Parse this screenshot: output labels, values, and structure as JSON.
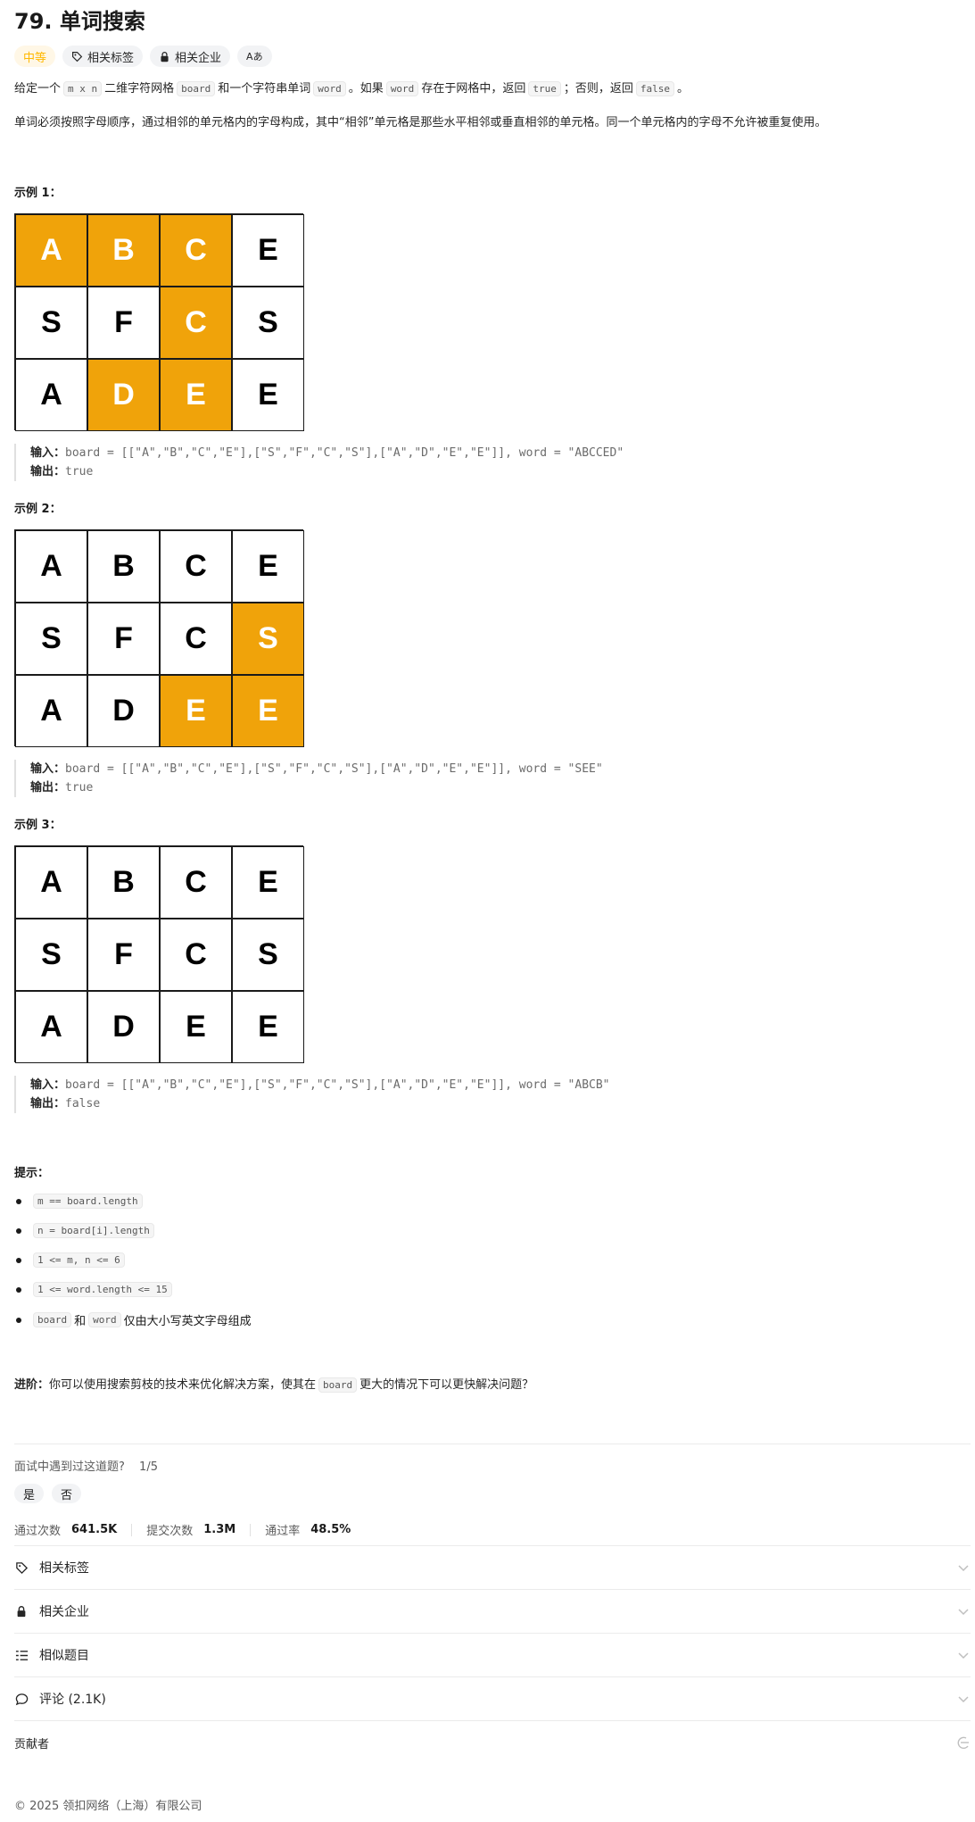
{
  "problem": {
    "title": "79. 单词搜索",
    "difficulty": "中等",
    "tag_related": "相关标签",
    "tag_companies": "相关企业",
    "tag_font": "Aあ"
  },
  "description": {
    "p1": {
      "t1": "给定一个",
      "c1": "m x n",
      "t2": "二维字符网格",
      "c2": "board",
      "t3": "和一个字符串单词",
      "c3": "word",
      "t4": "。如果",
      "c4": "word",
      "t5": "存在于网格中，返回",
      "c5": "true",
      "t6": "；否则，返回",
      "c6": "false",
      "t7": "。"
    },
    "p2": "单词必须按照字母顺序，通过相邻的单元格内的字母构成，其中“相邻”单元格是那些水平相邻或垂直相邻的单元格。同一个单元格内的字母不允许被重复使用。"
  },
  "examples": [
    {
      "label": "示例 1：",
      "board": [
        [
          "A",
          "B",
          "C",
          "E"
        ],
        [
          "S",
          "F",
          "C",
          "S"
        ],
        [
          "A",
          "D",
          "E",
          "E"
        ]
      ],
      "highlight": [
        [
          true,
          true,
          true,
          false
        ],
        [
          false,
          false,
          true,
          false
        ],
        [
          false,
          true,
          true,
          false
        ]
      ],
      "input_label": "输入：",
      "input": "board = [[\"A\",\"B\",\"C\",\"E\"],[\"S\",\"F\",\"C\",\"S\"],[\"A\",\"D\",\"E\",\"E\"]], word = \"ABCCED\"",
      "output_label": "输出：",
      "output": "true"
    },
    {
      "label": "示例 2：",
      "board": [
        [
          "A",
          "B",
          "C",
          "E"
        ],
        [
          "S",
          "F",
          "C",
          "S"
        ],
        [
          "A",
          "D",
          "E",
          "E"
        ]
      ],
      "highlight": [
        [
          false,
          false,
          false,
          false
        ],
        [
          false,
          false,
          false,
          true
        ],
        [
          false,
          false,
          true,
          true
        ]
      ],
      "input_label": "输入：",
      "input": "board = [[\"A\",\"B\",\"C\",\"E\"],[\"S\",\"F\",\"C\",\"S\"],[\"A\",\"D\",\"E\",\"E\"]], word = \"SEE\"",
      "output_label": "输出：",
      "output": "true"
    },
    {
      "label": "示例 3：",
      "board": [
        [
          "A",
          "B",
          "C",
          "E"
        ],
        [
          "S",
          "F",
          "C",
          "S"
        ],
        [
          "A",
          "D",
          "E",
          "E"
        ]
      ],
      "highlight": [
        [
          false,
          false,
          false,
          false
        ],
        [
          false,
          false,
          false,
          false
        ],
        [
          false,
          false,
          false,
          false
        ]
      ],
      "input_label": "输入：",
      "input": "board = [[\"A\",\"B\",\"C\",\"E\"],[\"S\",\"F\",\"C\",\"S\"],[\"A\",\"D\",\"E\",\"E\"]], word = \"ABCB\"",
      "output_label": "输出：",
      "output": "false"
    }
  ],
  "hints": {
    "title": "提示：",
    "items": [
      "m == board.length",
      "n = board[i].length",
      "1 <= m, n <= 6",
      "1 <= word.length <= 15"
    ],
    "last": {
      "c1": "board",
      "t1": "和",
      "c2": "word",
      "t2": "仅由大小写英文字母组成"
    }
  },
  "advanced": {
    "label": "进阶：",
    "t1": "你可以使用搜索剪枝的技术来优化解决方案，使其在",
    "code": "board",
    "t2": "更大的情况下可以更快解决问题？"
  },
  "interview": {
    "question": "面试中遇到过这道题?",
    "progress": "1/5",
    "yes": "是",
    "no": "否"
  },
  "stats": {
    "accepted_label": "通过次数",
    "accepted": "641.5K",
    "submissions_label": "提交次数",
    "submissions": "1.3M",
    "rate_label": "通过率",
    "rate": "48.5%"
  },
  "sections": {
    "tags": "相关标签",
    "companies": "相关企业",
    "similar": "相似题目",
    "comments": "评论 (2.1K)",
    "contributors": "贡献者"
  },
  "footer": "© 2025 领扣网络（上海）有限公司",
  "colors": {
    "highlight": "#f0a30a",
    "difficulty": "#ffb800"
  }
}
